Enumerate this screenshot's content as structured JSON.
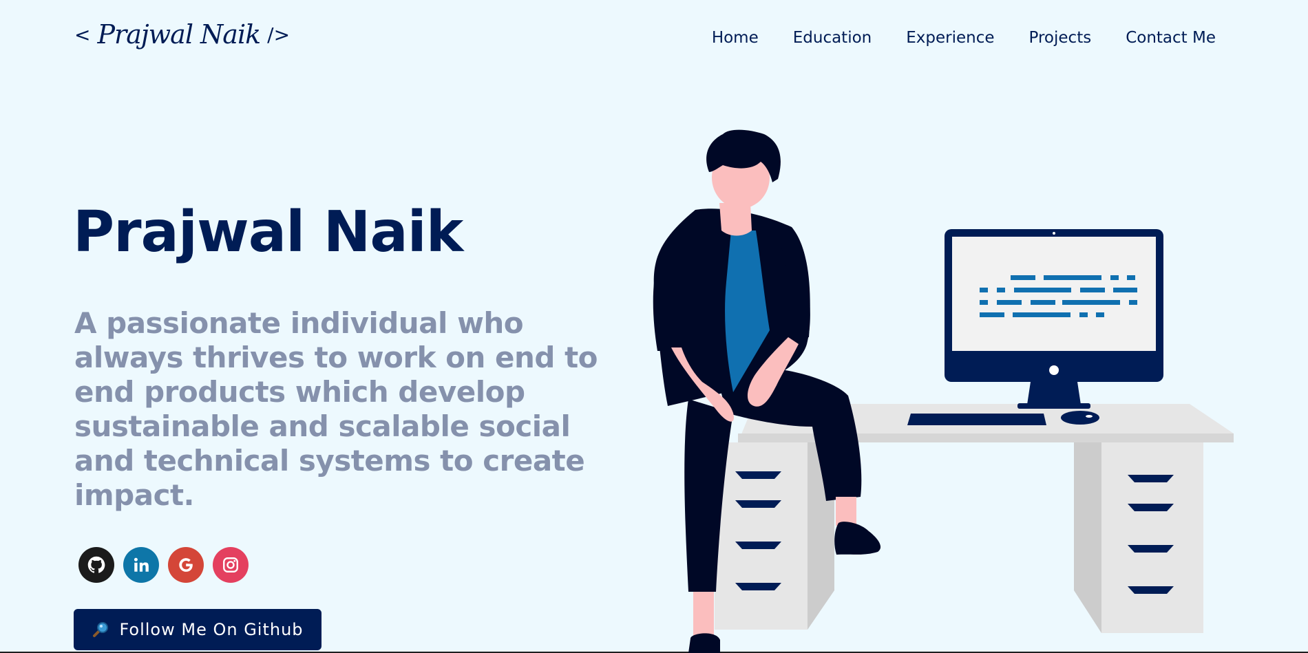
{
  "header": {
    "logo": {
      "open": "<",
      "signature": "Prajwal Naik",
      "close": "/>"
    },
    "nav": [
      "Home",
      "Education",
      "Experience",
      "Projects",
      "Contact Me"
    ]
  },
  "hero": {
    "name": "Prajwal Naik",
    "description": "A passionate individual who always thrives to work on end to end products which develop sustainable and scalable social and technical systems to create impact.",
    "socials": [
      {
        "name": "github-icon",
        "color": "#1b1b1b"
      },
      {
        "name": "linkedin-icon",
        "color": "#0e76a8"
      },
      {
        "name": "google-icon",
        "color": "#d44638"
      },
      {
        "name": "instagram-icon",
        "color": "#e4405f"
      }
    ],
    "button_icon": "magnifier-icon",
    "button_label": "Follow Me On Github"
  },
  "colors": {
    "background": "#edf9fe",
    "primary": "#001c55",
    "text_muted": "#8591ac",
    "shirt": "#1070b0",
    "skin": "#fbbebe",
    "desk": "#e6e6e6"
  }
}
